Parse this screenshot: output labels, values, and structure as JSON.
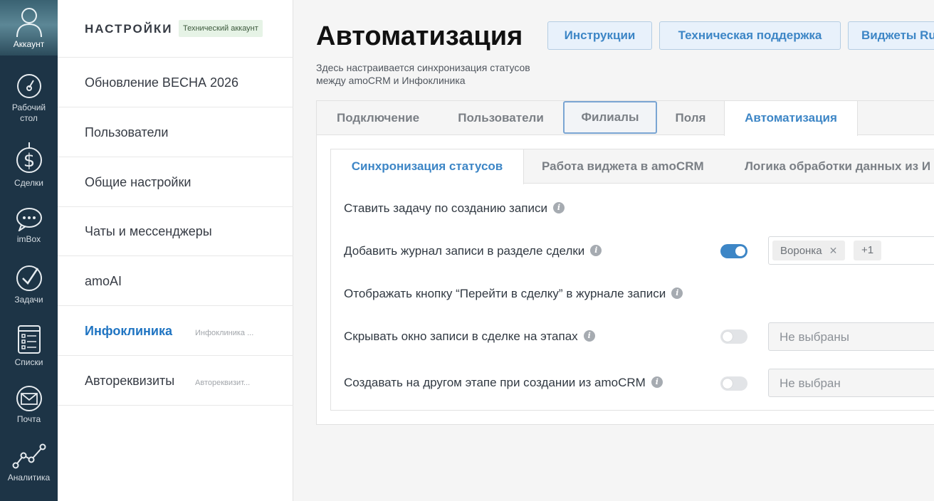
{
  "nav": {
    "account": "Аккаунт",
    "items": [
      {
        "label": "Рабочий стол",
        "icon": "gauge-icon"
      },
      {
        "label": "Сделки",
        "icon": "dollar-icon"
      },
      {
        "label": "imBox",
        "icon": "chat-bubble-icon"
      },
      {
        "label": "Задачи",
        "icon": "checkmark-icon"
      },
      {
        "label": "Списки",
        "icon": "list-icon"
      },
      {
        "label": "Почта",
        "icon": "mail-icon"
      },
      {
        "label": "Аналитика",
        "icon": "analytics-icon"
      }
    ]
  },
  "sidebar": {
    "title": "НАСТРОЙКИ",
    "badge": "Технический аккаунт",
    "items": [
      {
        "label": "Обновление ВЕСНА 2026",
        "sub": ""
      },
      {
        "label": "Пользователи",
        "sub": ""
      },
      {
        "label": "Общие настройки",
        "sub": ""
      },
      {
        "label": "Чаты и мессенджеры",
        "sub": ""
      },
      {
        "label": "amoAI",
        "sub": ""
      },
      {
        "label": "Инфоклиника",
        "sub": "Инфоклиника ..."
      },
      {
        "label": "Автореквизиты",
        "sub": "Автореквизит..."
      }
    ]
  },
  "header": {
    "title": "Автоматизация",
    "subtitle": "Здесь настраивается синхронизация статусов между amoCRM и Инфоклиника",
    "buttons": [
      "Инструкции",
      "Техническая поддержка",
      "Виджеты Ru"
    ]
  },
  "tabs": [
    "Подключение",
    "Пользователи",
    "Филиалы",
    "Поля",
    "Автоматизация"
  ],
  "subtabs": [
    "Синхронизация статусов",
    "Работа виджета в amoCRM",
    "Логика обработки данных из И"
  ],
  "settings": [
    {
      "label": "Ставить задачу по созданию записи",
      "info": "i"
    },
    {
      "label": "Добавить журнал записи в разделе сделки",
      "info": "i",
      "toggle": true,
      "chips": [
        "Воронка"
      ],
      "chips_more": "+1"
    },
    {
      "label": "Отображать кнопку “Перейти в сделку” в журнале записи",
      "info": "i"
    },
    {
      "label": "Скрывать окно записи в сделке на этапах",
      "info": "i",
      "toggle": false,
      "placeholder": "Не выбраны"
    },
    {
      "label": "Создавать на другом этапе при создании из amoCRM",
      "info": "i",
      "toggle": false,
      "placeholder": "Не выбран"
    }
  ],
  "colors": {
    "accent": "#3d86c6",
    "nav_bg": "#1d3446",
    "active_link": "#1f74c2"
  }
}
